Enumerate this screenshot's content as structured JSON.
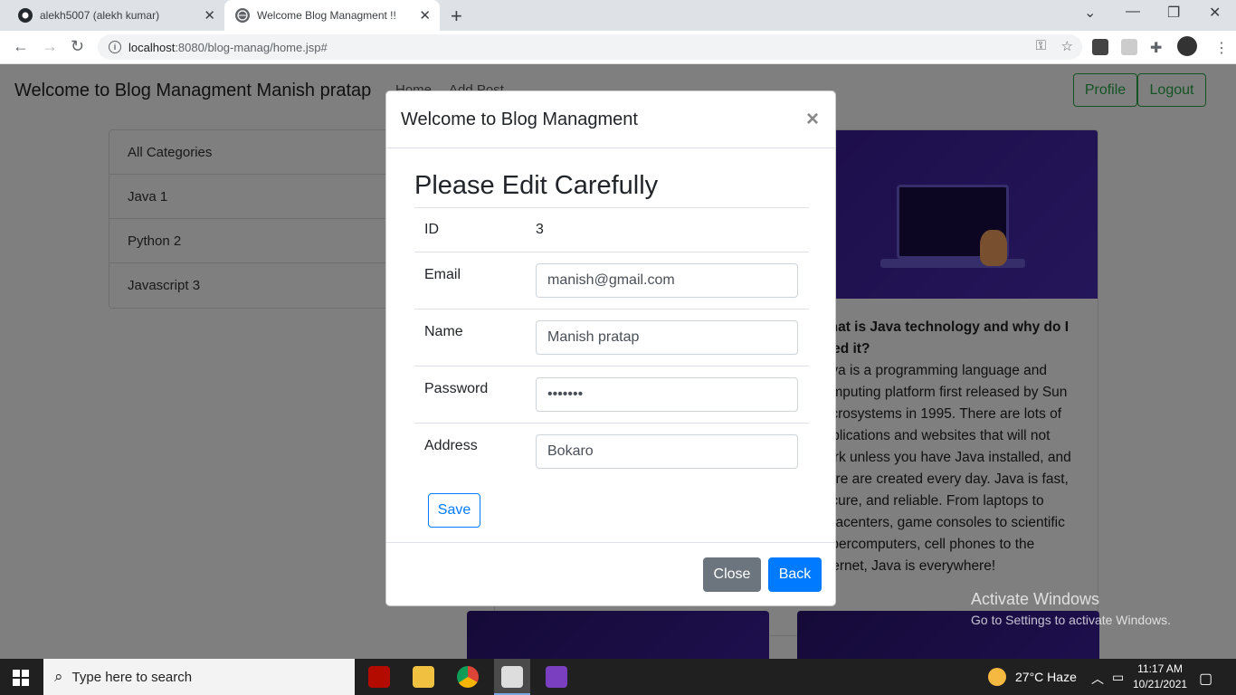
{
  "browser": {
    "tabs": [
      {
        "title": "alekh5007 (alekh kumar)",
        "icon": "github-icon"
      },
      {
        "title": "Welcome Blog Managment !!",
        "icon": "globe-icon"
      }
    ],
    "url_host": "localhost",
    "url_rest": ":8080/blog-manag/home.jsp#"
  },
  "navbar": {
    "brand": "Welcome to Blog Managment Manish pratap",
    "links": [
      "Home",
      "Add Post"
    ],
    "profile_label": "Profile",
    "logout_label": "Logout"
  },
  "categories": [
    "All Categories",
    "Java 1",
    "Python 2",
    "Javascript 3"
  ],
  "post": {
    "title": "What is Java technology and why do I need it?",
    "body": "Java is a programming language and computing platform first released by Sun Microsystems in 1995. There are lots of applications and websites that will not work unless you have Java installed, and more are created every day. Java is fast, secure, and reliable. From laptops to datacenters, game consoles to scientific supercomputers, cell phones to the Internet, Java is everywhere!"
  },
  "modal": {
    "title": "Welcome to Blog Managment",
    "heading": "Please Edit Carefully",
    "fields": {
      "id_label": "ID",
      "id_value": "3",
      "email_label": "Email",
      "email_value": "manish@gmail.com",
      "name_label": "Name",
      "name_value": "Manish pratap",
      "password_label": "Password",
      "password_value": "•••••••",
      "address_label": "Address",
      "address_value": "Bokaro"
    },
    "save_label": "Save",
    "close_label": "Close",
    "back_label": "Back"
  },
  "watermark": {
    "line1": "Activate Windows",
    "line2": "Go to Settings to activate Windows."
  },
  "taskbar": {
    "search_placeholder": "Type here to search",
    "weather": "27°C  Haze",
    "time": "11:17 AM",
    "date": "10/21/2021"
  }
}
